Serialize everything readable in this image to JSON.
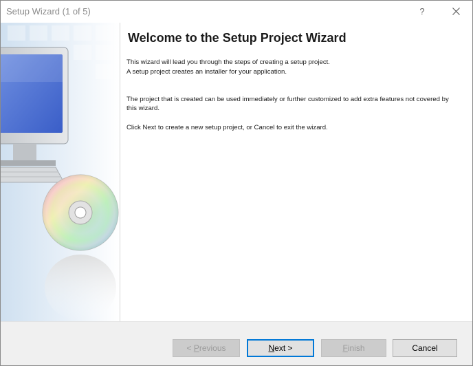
{
  "window": {
    "title": "Setup Wizard (1 of 5)",
    "help_label": "?"
  },
  "content": {
    "heading": "Welcome to the Setup Project Wizard",
    "paragraphs": [
      "This wizard will lead you through the steps of creating a setup project.",
      "A setup project creates an installer for your application.",
      "The project that is created can be used immediately or further customized to add extra features not covered by this wizard.",
      "Click Next to create a new setup project, or Cancel to exit the wizard."
    ]
  },
  "buttons": {
    "previous": {
      "prefix": "< ",
      "mnemonic": "P",
      "rest": "revious",
      "enabled": false
    },
    "next": {
      "mnemonic": "N",
      "rest": "ext >",
      "enabled": true,
      "default": true
    },
    "finish": {
      "mnemonic": "F",
      "rest": "inish",
      "enabled": false
    },
    "cancel": {
      "label": "Cancel",
      "enabled": true
    }
  },
  "colors": {
    "accent": "#0078d7",
    "title_text": "#8c8c8c",
    "button_bar": "#f0f0f0"
  },
  "icons": {
    "close": "close-icon",
    "help": "help-icon",
    "wizard_image": "computer-and-cd-illustration"
  }
}
